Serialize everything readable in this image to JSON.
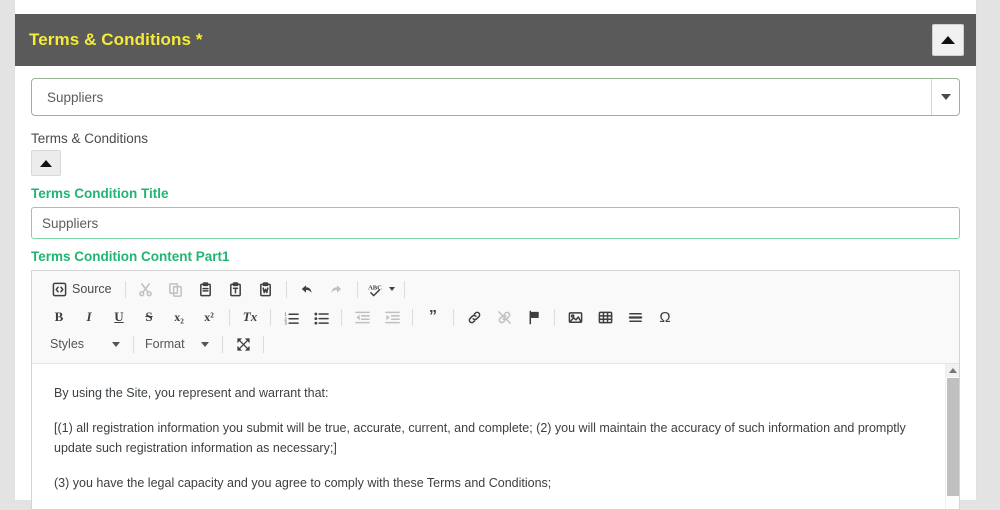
{
  "panel": {
    "title": "Terms & Conditions",
    "required_marker": "*",
    "collapse_button": "collapse-panel"
  },
  "form": {
    "category_select": {
      "value": "Suppliers",
      "placeholder": "Suppliers"
    },
    "section_label": "Terms & Conditions",
    "section_toggle": "collapse-section",
    "title_field": {
      "label": "Terms Condition Title",
      "value": "Suppliers",
      "placeholder": "Suppliers"
    },
    "content_field": {
      "label": "Terms Condition Content Part1"
    }
  },
  "editor": {
    "toolbar_rows": [
      [
        {
          "name": "source",
          "label": "Source",
          "type": "text",
          "disabled": false
        },
        {
          "name": "separator",
          "type": "sep"
        },
        {
          "name": "cut",
          "label": "",
          "type": "icon",
          "disabled": true
        },
        {
          "name": "copy",
          "label": "",
          "type": "icon",
          "disabled": true
        },
        {
          "name": "paste",
          "label": "",
          "type": "icon",
          "disabled": false
        },
        {
          "name": "paste-text",
          "label": "",
          "type": "icon",
          "disabled": false
        },
        {
          "name": "paste-from-word",
          "label": "",
          "type": "icon",
          "disabled": false
        },
        {
          "name": "separator",
          "type": "sep"
        },
        {
          "name": "undo",
          "label": "",
          "type": "icon",
          "disabled": false
        },
        {
          "name": "redo",
          "label": "",
          "type": "icon",
          "disabled": true
        },
        {
          "name": "separator",
          "type": "sep"
        },
        {
          "name": "spell-check",
          "label": "",
          "type": "icon",
          "disabled": false
        },
        {
          "name": "separator",
          "type": "sep"
        }
      ],
      [
        {
          "name": "bold",
          "label": "B",
          "disabled": false
        },
        {
          "name": "italic",
          "label": "I",
          "disabled": false
        },
        {
          "name": "underline",
          "label": "U",
          "disabled": false
        },
        {
          "name": "strikethrough",
          "label": "S",
          "disabled": false
        },
        {
          "name": "subscript",
          "label": "x₂",
          "disabled": false
        },
        {
          "name": "superscript",
          "label": "x²",
          "disabled": false
        },
        {
          "name": "separator",
          "type": "sep"
        },
        {
          "name": "remove-format",
          "label": "Tx",
          "disabled": false
        },
        {
          "name": "separator",
          "type": "sep"
        },
        {
          "name": "numbered-list",
          "label": "",
          "disabled": false
        },
        {
          "name": "bulleted-list",
          "label": "",
          "disabled": false
        },
        {
          "name": "separator",
          "type": "sep"
        },
        {
          "name": "decrease-indent",
          "label": "",
          "disabled": true
        },
        {
          "name": "increase-indent",
          "label": "",
          "disabled": true
        },
        {
          "name": "separator",
          "type": "sep"
        },
        {
          "name": "blockquote",
          "label": "",
          "disabled": false
        },
        {
          "name": "separator",
          "type": "sep"
        },
        {
          "name": "link",
          "label": "",
          "disabled": false
        },
        {
          "name": "unlink",
          "label": "",
          "disabled": true
        },
        {
          "name": "anchor",
          "label": "",
          "disabled": false
        },
        {
          "name": "separator",
          "type": "sep"
        },
        {
          "name": "image",
          "label": "",
          "disabled": false
        },
        {
          "name": "table",
          "label": "",
          "disabled": false
        },
        {
          "name": "horizontal-rule",
          "label": "",
          "disabled": false
        },
        {
          "name": "special-character",
          "label": "Ω",
          "disabled": false
        }
      ]
    ],
    "styles_dropdown": "Styles",
    "format_dropdown": "Format",
    "maximize_button": "maximize",
    "content_paragraphs": [
      "By using the Site, you represent and warrant that:",
      "[(1) all registration information you submit will be true, accurate, current, and complete; (2) you will maintain the accuracy of such information and promptly update such registration information as necessary;]",
      "(3) you have the legal capacity and you agree to comply with these Terms and Conditions;"
    ]
  },
  "colors": {
    "header_bg": "#5a5a5a",
    "header_text": "#f5eb38",
    "label_green": "#21b573",
    "input_border_green": "#7fd5ab",
    "select_border_green": "#9ab795"
  }
}
